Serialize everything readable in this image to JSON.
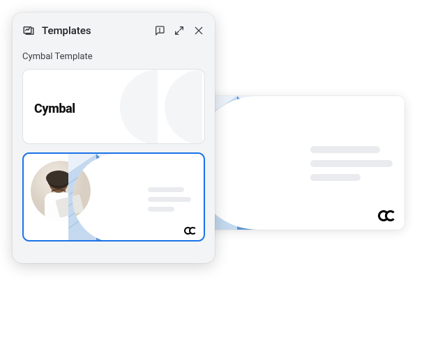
{
  "panel": {
    "title": "Templates",
    "section": "Cymbal Template"
  },
  "thumbnails": [
    {
      "label": "Cymbal"
    },
    {
      "label": ""
    }
  ],
  "colors": {
    "accent": "#1a73e8",
    "placeholder": "#e9ebee",
    "building_light": "#e5eef8",
    "building_blue": "#6ea4d8"
  }
}
